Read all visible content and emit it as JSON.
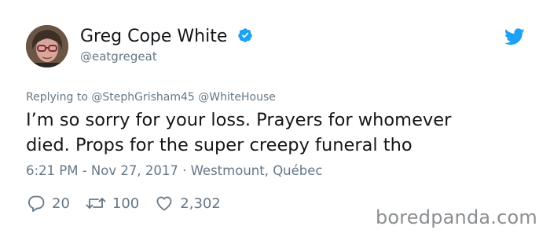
{
  "user": {
    "display_name": "Greg Cope White",
    "handle": "@eatgregeat",
    "verified": true
  },
  "tweet": {
    "replying_prefix": "Replying to ",
    "replying_mentions": "@StephGrisham45 @WhiteHouse",
    "text_line_1": "I’m so sorry for your loss. Prayers for whomever",
    "text_line_2": "died. Props for the super creepy funeral tho",
    "timestamp_location": "6:21 PM - Nov 27, 2017 · Westmount, Québec"
  },
  "actions": {
    "replies": "20",
    "retweets": "100",
    "likes": "2,302"
  },
  "icons": {
    "avatar": "profile-photo",
    "verified": "verified-badge-icon",
    "brand": "twitter-bird-icon",
    "reply": "reply-icon",
    "retweet": "retweet-icon",
    "like": "heart-icon"
  },
  "colors": {
    "accent": "#1da1f2",
    "text": "#14171a",
    "muted": "#657786"
  },
  "watermark": "boredpanda.com"
}
